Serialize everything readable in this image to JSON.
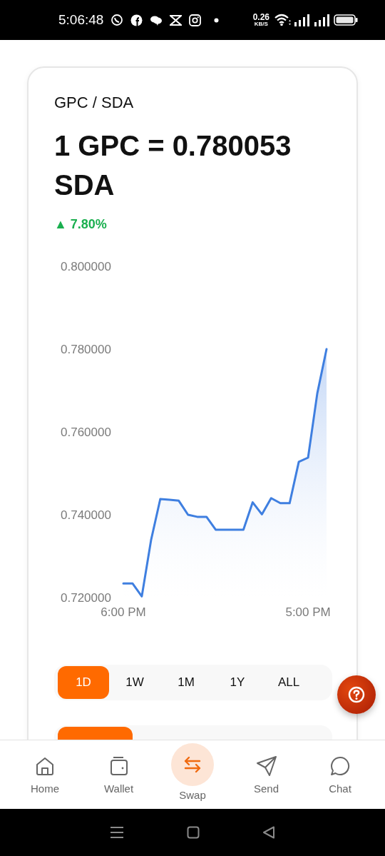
{
  "status_bar": {
    "time": "5:06:48",
    "speed_value": "0.26",
    "speed_unit": "KB/S"
  },
  "pair": "GPC / SDA",
  "rate": "1 GPC = 0.780053 SDA",
  "change": {
    "text": "▲ 7.80%"
  },
  "chart": {
    "chart_data": {
      "type": "area",
      "categories": [
        "6:00 PM",
        null,
        null,
        null,
        null,
        null,
        null,
        null,
        null,
        null,
        null,
        null,
        null,
        null,
        null,
        null,
        null,
        null,
        null,
        null,
        "5:00 PM",
        null,
        null
      ],
      "values": [
        0.7234,
        0.7234,
        0.7203,
        0.7339,
        0.7438,
        0.7436,
        0.7434,
        0.74,
        0.7395,
        0.7395,
        0.7364,
        0.7364,
        0.7364,
        0.7364,
        0.743,
        0.7401,
        0.744,
        0.7428,
        0.7428,
        0.7528,
        0.7538,
        0.7693,
        0.78
      ],
      "ylim": [
        0.72,
        0.8
      ],
      "yticks": [
        {
          "value": 0.8,
          "label": "0.800000"
        },
        {
          "value": 0.78,
          "label": "0.780000"
        },
        {
          "value": 0.76,
          "label": "0.760000"
        },
        {
          "value": 0.74,
          "label": "0.740000"
        },
        {
          "value": 0.72,
          "label": "0.720000"
        }
      ]
    }
  },
  "ranges": [
    {
      "label": "1D",
      "selected": true
    },
    {
      "label": "1W",
      "selected": false
    },
    {
      "label": "1M",
      "selected": false
    },
    {
      "label": "1Y",
      "selected": false
    },
    {
      "label": "ALL",
      "selected": false
    }
  ],
  "metric_tabs": [
    {
      "selected": true
    }
  ],
  "nav": [
    {
      "kind": "home",
      "label": "Home",
      "selected": false
    },
    {
      "kind": "wallet",
      "label": "Wallet",
      "selected": false
    },
    {
      "kind": "swap",
      "label": "Swap",
      "selected": true
    },
    {
      "kind": "send",
      "label": "Send",
      "selected": false
    },
    {
      "kind": "chat",
      "label": "Chat",
      "selected": false
    }
  ]
}
